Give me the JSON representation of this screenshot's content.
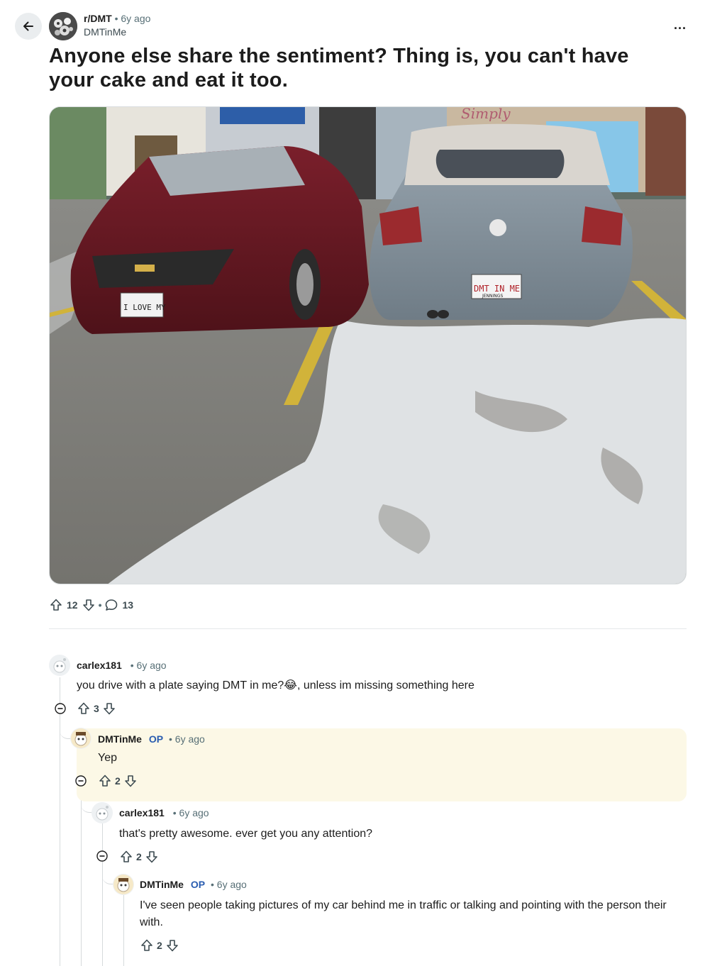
{
  "header": {
    "subreddit": "r/DMT",
    "separator": "•",
    "age": "6y ago",
    "author": "DMTinMe",
    "more_label": "..."
  },
  "post": {
    "title": "Anyone else share the sentiment? Thing is, you can't have your cake and eat it too.",
    "image": {
      "plate_left": "I LOVE MY",
      "plate_right": "DMT IN ME",
      "plate_right_footer": "JENNINGS",
      "store_sign": "Simply"
    },
    "upvotes": "12",
    "separator": "•",
    "comments": "13"
  },
  "comments": [
    {
      "user": "carlex181",
      "op": "",
      "separator": "•",
      "age": "6y ago",
      "body": "you drive with a plate saying DMT in me?😂, unless im missing something here",
      "votes": "3"
    },
    {
      "user": "DMTinMe",
      "op": "OP",
      "separator": "•",
      "age": "6y ago",
      "body": "Yep",
      "votes": "2",
      "highlight_color": "#fcf8e6"
    },
    {
      "user": "carlex181",
      "op": "",
      "separator": "•",
      "age": "6y ago",
      "body": "that's pretty awesome. ever get you any attention?",
      "votes": "2"
    },
    {
      "user": "DMTinMe",
      "op": "OP",
      "separator": "•",
      "age": "6y ago",
      "body": "I've seen people taking pictures of my car behind me in traffic or talking and pointing with the person their with.",
      "votes": "2"
    }
  ],
  "icons": [
    "back-arrow-icon",
    "more-icon",
    "upvote-icon",
    "downvote-icon",
    "comment-icon",
    "collapse-icon",
    "avatar-icon"
  ],
  "colors": {
    "op_blue": "#2a5db0",
    "meta_gray": "#576f76",
    "highlight": "#fcf8e6"
  }
}
